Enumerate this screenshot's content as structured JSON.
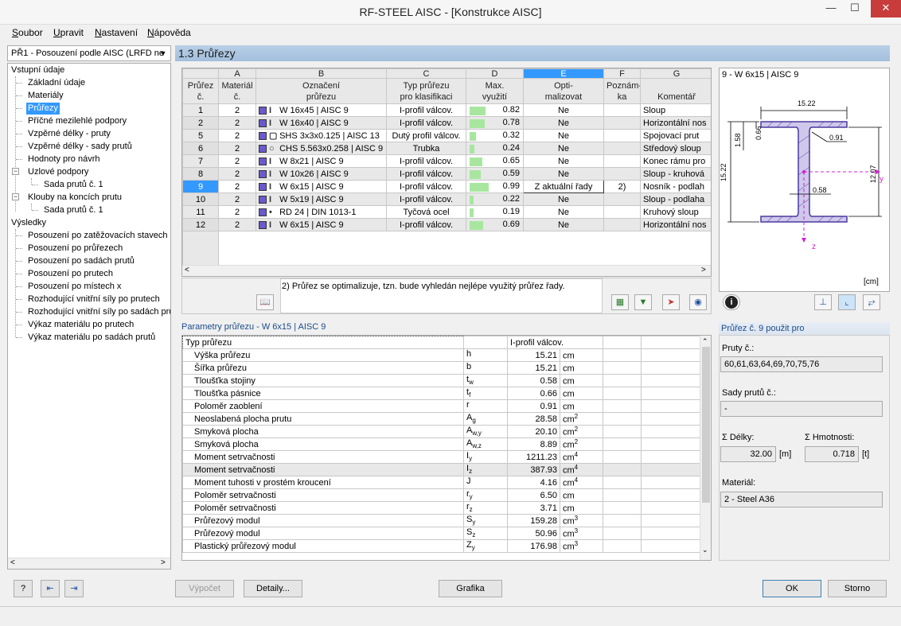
{
  "window": {
    "title": "RF-STEEL AISC - [Konstrukce AISC]"
  },
  "menu": [
    {
      "first": "S",
      "rest": "oubor"
    },
    {
      "first": "U",
      "rest": "pravit"
    },
    {
      "first": "N",
      "rest": "astavení"
    },
    {
      "first": "N",
      "rest": "ápověda"
    }
  ],
  "case_select": "PŘ1 - Posouzení podle AISC (LRFD ne",
  "nav": {
    "input_group": "Vstupní údaje",
    "items": [
      "Základní údaje",
      "Materiály",
      "Průřezy",
      "Příčné mezilehlé podpory",
      "Vzpěrné délky - pruty",
      "Vzpěrné délky - sady prutů",
      "Hodnoty pro návrh",
      "Uzlové podpory",
      "Sada prutů č. 1",
      "Klouby na koncích prutu",
      "Sada prutů č. 1"
    ],
    "results_group": "Výsledky",
    "results": [
      "Posouzení po zatěžovacích stavech",
      "Posouzení po průřezech",
      "Posouzení po sadách prutů",
      "Posouzení po prutech",
      "Posouzení po místech x",
      "Rozhodující vnitřní síly po prutech",
      "Rozhodující vnitřní síly po sadách prut",
      "Výkaz materiálu po prutech",
      "Výkaz materiálu po sadách prutů"
    ]
  },
  "section_header": "1.3 Průřezy",
  "table": {
    "col_letters": [
      "A",
      "B",
      "C",
      "D",
      "E",
      "F",
      "G"
    ],
    "headers": [
      [
        "Průřez",
        "č."
      ],
      [
        "Materiál",
        "č."
      ],
      [
        "Označení",
        "průřezu"
      ],
      [
        "Typ průřezu",
        "pro klasifikaci"
      ],
      [
        "Max.",
        "využití"
      ],
      [
        "Opti-",
        "malizovat"
      ],
      [
        "Poznám-",
        "ka"
      ],
      [
        "",
        "Komentář"
      ]
    ],
    "rows": [
      {
        "no": "1",
        "mat": "2",
        "name": "W 16x45 | AISC 9",
        "type": "I-profil válcov.",
        "util": "0.82",
        "opt": "Ne",
        "note": "",
        "comment": "Sloup",
        "icon": "I"
      },
      {
        "no": "2",
        "mat": "2",
        "name": "W 16x40 | AISC 9",
        "type": "I-profil válcov.",
        "util": "0.78",
        "opt": "Ne",
        "note": "",
        "comment": "Horizontální nos",
        "icon": "I"
      },
      {
        "no": "5",
        "mat": "2",
        "name": "SHS 3x3x0.125 | AISC 13",
        "type": "Dutý profil válcov.",
        "util": "0.32",
        "opt": "Ne",
        "note": "",
        "comment": "Spojovací prut",
        "icon": "▢"
      },
      {
        "no": "6",
        "mat": "2",
        "name": "CHS 5.563x0.258 | AISC 9",
        "type": "Trubka",
        "util": "0.24",
        "opt": "Ne",
        "note": "",
        "comment": "Středový sloup",
        "icon": "○"
      },
      {
        "no": "7",
        "mat": "2",
        "name": "W 8x21 | AISC 9",
        "type": "I-profil válcov.",
        "util": "0.65",
        "opt": "Ne",
        "note": "",
        "comment": "Konec rámu pro",
        "icon": "I"
      },
      {
        "no": "8",
        "mat": "2",
        "name": "W 10x26 | AISC 9",
        "type": "I-profil válcov.",
        "util": "0.59",
        "opt": "Ne",
        "note": "",
        "comment": "Sloup - kruhová",
        "icon": "I"
      },
      {
        "no": "9",
        "mat": "2",
        "name": "W 6x15 | AISC 9",
        "type": "I-profil válcov.",
        "util": "0.99",
        "opt": "Z aktuální řady",
        "note": "2)",
        "comment": "Nosník - podlah",
        "icon": "I"
      },
      {
        "no": "10",
        "mat": "2",
        "name": "W 5x19 | AISC 9",
        "type": "I-profil válcov.",
        "util": "0.22",
        "opt": "Ne",
        "note": "",
        "comment": "Sloup - podlaha",
        "icon": "I"
      },
      {
        "no": "11",
        "mat": "2",
        "name": "RD 24 | DIN 1013-1",
        "type": "Tyčová ocel",
        "util": "0.19",
        "opt": "Ne",
        "note": "",
        "comment": "Kruhový sloup",
        "icon": "•"
      },
      {
        "no": "12",
        "mat": "2",
        "name": "W 6x15 | AISC 9",
        "type": "I-profil válcov.",
        "util": "0.69",
        "opt": "Ne",
        "note": "",
        "comment": "Horizontální nos",
        "icon": "I"
      }
    ]
  },
  "footnote": "2) Průřez se optimalizuje, tzn. bude vyhledán nejlépe využitý průřez řady.",
  "section_panel": {
    "title": "9 - W 6x15 | AISC 9",
    "dim_width": "15.22",
    "dim_height": "15.22",
    "dim_flange": "1.58",
    "dim_tf": "0.66",
    "dim_r": "0.91",
    "dim_web": "0.58",
    "dim_inner": "12.07",
    "axis_y": "y",
    "axis_z": "z",
    "unit": "[cm]"
  },
  "params": {
    "header": "Parametry průřezu  -  W 6x15 | AISC 9",
    "rows": [
      {
        "name": "Typ průřezu",
        "sym": "",
        "sub": "",
        "val": "I-profil válcov.",
        "unit": "",
        "sup": ""
      },
      {
        "name": "Výška průřezu",
        "sym": "h",
        "sub": "",
        "val": "15.21",
        "unit": "cm",
        "sup": ""
      },
      {
        "name": "Šířka průřezu",
        "sym": "b",
        "sub": "",
        "val": "15.21",
        "unit": "cm",
        "sup": ""
      },
      {
        "name": "Tloušťka stojiny",
        "sym": "t",
        "sub": "w",
        "val": "0.58",
        "unit": "cm",
        "sup": ""
      },
      {
        "name": "Tloušťka pásnice",
        "sym": "t",
        "sub": "f",
        "val": "0.66",
        "unit": "cm",
        "sup": ""
      },
      {
        "name": "Poloměr zaoblení",
        "sym": "r",
        "sub": "",
        "val": "0.91",
        "unit": "cm",
        "sup": ""
      },
      {
        "name": "Neoslabená plocha prutu",
        "sym": "A",
        "sub": "g",
        "val": "28.58",
        "unit": "cm",
        "sup": "2"
      },
      {
        "name": "Smyková plocha",
        "sym": "A",
        "sub": "w,y",
        "val": "20.10",
        "unit": "cm",
        "sup": "2"
      },
      {
        "name": "Smyková plocha",
        "sym": "A",
        "sub": "w,z",
        "val": "8.89",
        "unit": "cm",
        "sup": "2"
      },
      {
        "name": "Moment setrvačnosti",
        "sym": "I",
        "sub": "y",
        "val": "1211.23",
        "unit": "cm",
        "sup": "4"
      },
      {
        "name": "Moment setrvačnosti",
        "sym": "I",
        "sub": "z",
        "val": "387.93",
        "unit": "cm",
        "sup": "4"
      },
      {
        "name": "Moment tuhosti v prostém kroucení",
        "sym": "J",
        "sub": "",
        "val": "4.16",
        "unit": "cm",
        "sup": "4"
      },
      {
        "name": "Poloměr setrvačnosti",
        "sym": "r",
        "sub": "y",
        "val": "6.50",
        "unit": "cm",
        "sup": ""
      },
      {
        "name": "Poloměr setrvačnosti",
        "sym": "r",
        "sub": "z",
        "val": "3.71",
        "unit": "cm",
        "sup": ""
      },
      {
        "name": "Průřezový modul",
        "sym": "S",
        "sub": "y",
        "val": "159.28",
        "unit": "cm",
        "sup": "3"
      },
      {
        "name": "Průřezový modul",
        "sym": "S",
        "sub": "z",
        "val": "50.96",
        "unit": "cm",
        "sup": "3"
      },
      {
        "name": "Plastický průřezový modul",
        "sym": "Z",
        "sub": "y",
        "val": "176.98",
        "unit": "cm",
        "sup": "3"
      }
    ]
  },
  "info": {
    "header": "Průřez č. 9 použit pro",
    "members_label": "Pruty č.:",
    "members_value": "60,61,63,64,69,70,75,76",
    "sets_label": "Sady prutů č.:",
    "sets_value": "-",
    "length_label": "Σ  Délky:",
    "length_value": "32.00",
    "length_unit": "[m]",
    "mass_label": "Σ  Hmotnosti:",
    "mass_value": "0.718",
    "mass_unit": "[t]",
    "material_label": "Materiál:",
    "material_value": "2 - Steel A36"
  },
  "buttons": {
    "calc": "Výpočet",
    "details": "Detaily...",
    "graphics": "Grafika",
    "ok": "OK",
    "cancel": "Storno"
  }
}
